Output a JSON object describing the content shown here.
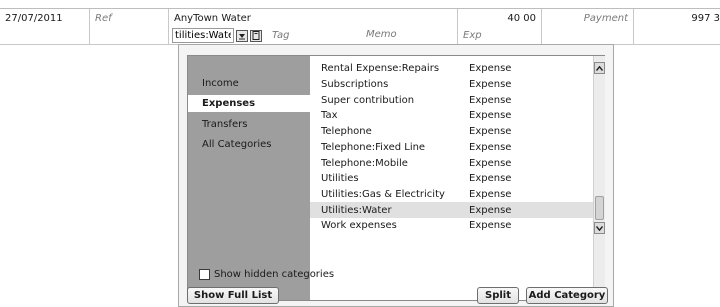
{
  "register": {
    "row1": {
      "date": "27/07/2011",
      "ref_placeholder": "Ref",
      "payee": "AnyTown Water",
      "amount": "40 00",
      "type_placeholder": "Payment",
      "balance": "997 3"
    },
    "row2": {
      "category_value": "tilities:Water",
      "tag_placeholder": "Tag",
      "memo_placeholder": "Memo",
      "exp_placeholder": "Exp"
    }
  },
  "popup": {
    "sidebar": [
      {
        "label": "Income",
        "active": false
      },
      {
        "label": "Expenses",
        "active": true
      },
      {
        "label": "Transfers",
        "active": false
      },
      {
        "label": "All Categories",
        "active": false
      }
    ],
    "categories": [
      {
        "name": "Rental Expense:Repairs",
        "type": "Expense"
      },
      {
        "name": "Subscriptions",
        "type": "Expense"
      },
      {
        "name": "Super contribution",
        "type": "Expense"
      },
      {
        "name": "Tax",
        "type": "Expense"
      },
      {
        "name": "Telephone",
        "type": "Expense"
      },
      {
        "name": "Telephone:Fixed Line",
        "type": "Expense"
      },
      {
        "name": "Telephone:Mobile",
        "type": "Expense"
      },
      {
        "name": "Utilities",
        "type": "Expense"
      },
      {
        "name": "Utilities:Gas & Electricity",
        "type": "Expense"
      },
      {
        "name": "Utilities:Water",
        "type": "Expense",
        "selected": true
      },
      {
        "name": "Work expenses",
        "type": "Expense"
      }
    ],
    "show_hidden_label": "Show hidden categories",
    "show_full_list_label": "Show Full List",
    "split_label": "Split",
    "add_category_label": "Add Category"
  },
  "icons": [
    "down-arrow-icon",
    "split-detail-icon",
    "scroll-up-icon",
    "scroll-down-icon"
  ]
}
